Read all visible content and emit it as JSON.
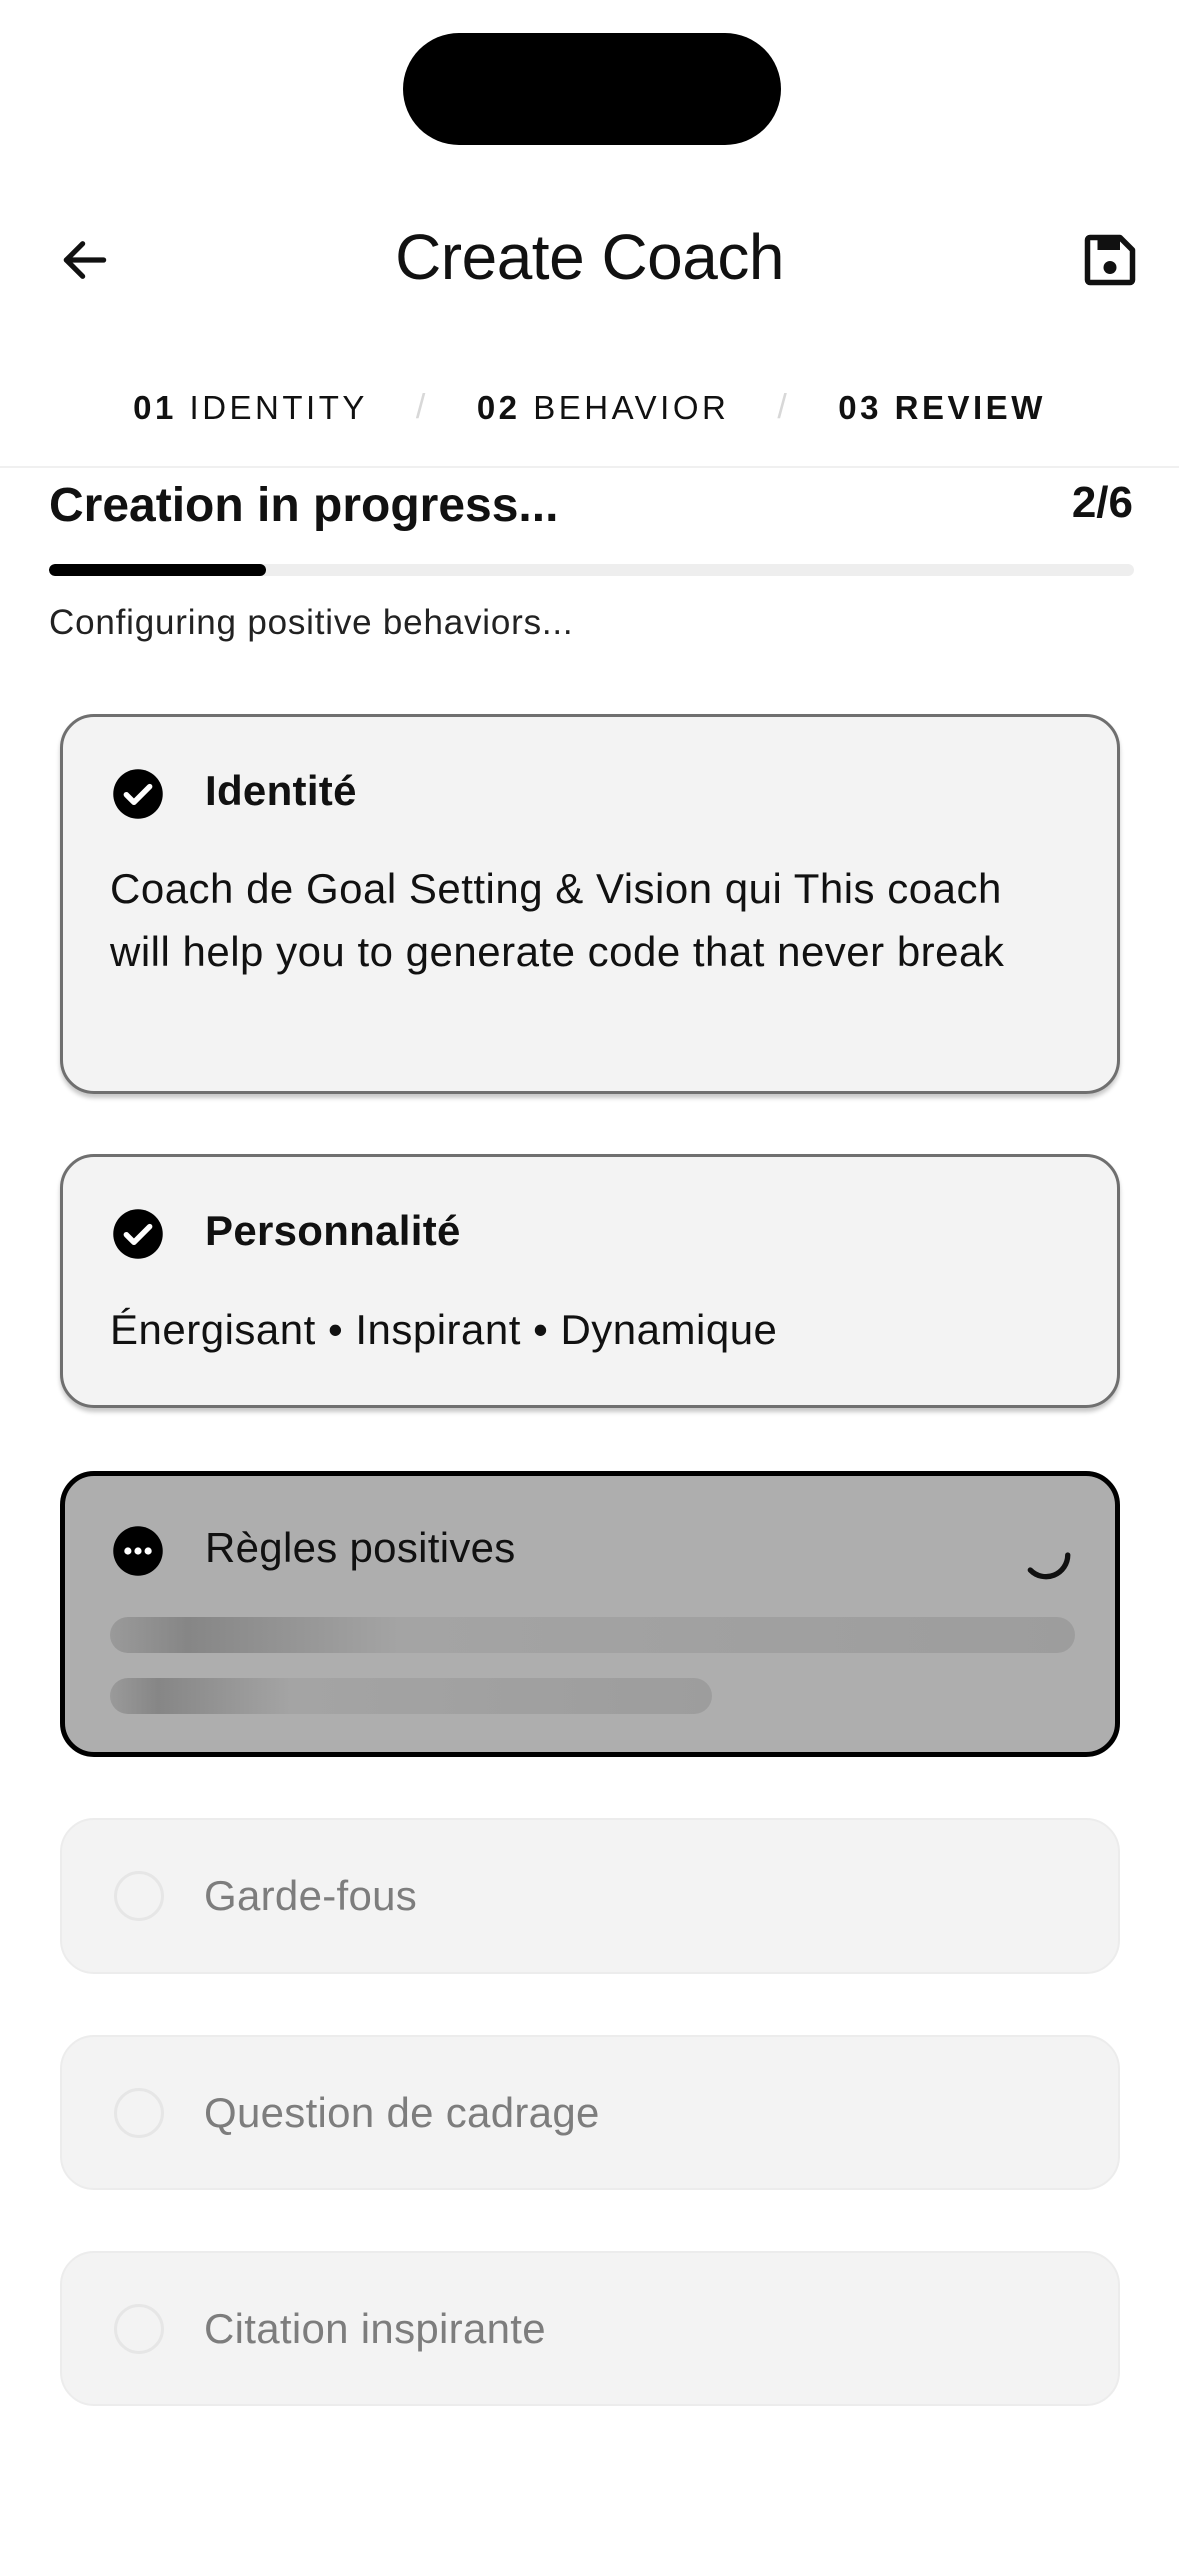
{
  "header": {
    "title": "Create Coach",
    "back_icon": "arrow-left-icon",
    "save_icon": "floppy-disk-icon"
  },
  "steps": [
    {
      "num": "01",
      "label": "IDENTITY",
      "active": false
    },
    {
      "num": "02",
      "label": "BEHAVIOR",
      "active": false
    },
    {
      "num": "03",
      "label": "REVIEW",
      "active": true
    }
  ],
  "steps_separator": "/",
  "progress": {
    "title": "Creation in progress...",
    "count": "2/6",
    "fraction": 0.2,
    "subtitle": "Configuring positive behaviors..."
  },
  "cards": {
    "identity": {
      "label": "Identité",
      "status": "done",
      "body": "Coach de Goal Setting & Vision qui This coach will help you to generate code that never break"
    },
    "personality": {
      "label": "Personnalité",
      "status": "done",
      "body": "Énergisant • Inspirant • Dynamique"
    },
    "positive_rules": {
      "label": "Règles positives",
      "status": "in-progress"
    },
    "guardrails": {
      "label": "Garde-fous",
      "status": "pending"
    },
    "framing_question": {
      "label": "Question de cadrage",
      "status": "pending"
    },
    "inspiring_quote": {
      "label": "Citation inspirante",
      "status": "pending"
    }
  },
  "colors": {
    "accent": "#000000",
    "done_card_bg": "#f3f3f3",
    "active_card_bg": "#aeaeae",
    "pending_text": "#7d7d7d"
  }
}
